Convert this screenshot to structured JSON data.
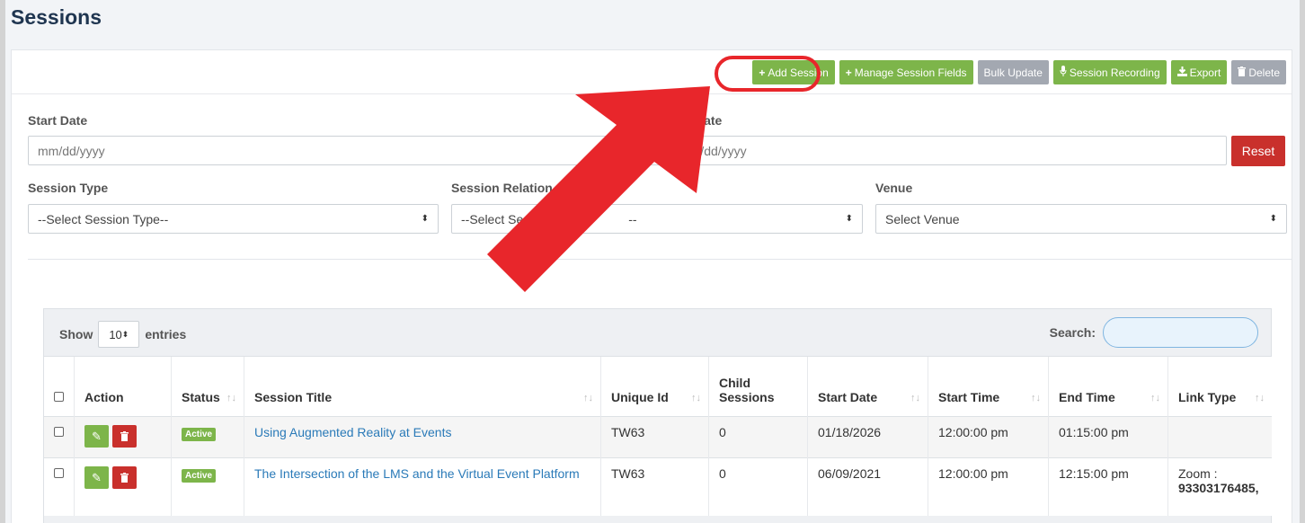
{
  "page_title": "Sessions",
  "toolbar": {
    "add_session": "Add Session",
    "manage_fields": "Manage Session Fields",
    "bulk_update": "Bulk Update",
    "session_recording": "Session Recording",
    "export": "Export",
    "delete": "Delete"
  },
  "filters": {
    "start_date_label": "Start Date",
    "start_date_placeholder": "mm/dd/yyyy",
    "end_date_label": "Date",
    "end_date_placeholder": "mm/dd/yyyy",
    "reset": "Reset",
    "session_type_label": "Session Type",
    "session_type_value": "--Select Session Type--",
    "session_relation_label": "Session Relation",
    "session_relation_value": "--Select Ses",
    "session_relation_value_tail": "--",
    "venue_label": "Venue",
    "venue_value": "Select Venue"
  },
  "table": {
    "show_label": "Show",
    "per_page": "10",
    "entries_label": "entries",
    "search_label": "Search:",
    "headers": {
      "action": "Action",
      "status": "Status",
      "title": "Session Title",
      "unique_id": "Unique Id",
      "child": "Child Sessions",
      "start_date": "Start Date",
      "start_time": "Start Time",
      "end_time": "End Time",
      "link_type": "Link Type"
    },
    "rows": [
      {
        "status": "Active",
        "title": "Using Augmented Reality at Events",
        "unique_id": "TW63",
        "child": "0",
        "start_date": "01/18/2026",
        "start_time": "12:00:00 pm",
        "end_time": "01:15:00 pm",
        "link_type": "",
        "link_number": ""
      },
      {
        "status": "Active",
        "title": "The Intersection of the LMS and the Virtual Event Platform",
        "unique_id": "TW63",
        "child": "0",
        "start_date": "06/09/2021",
        "start_time": "12:00:00 pm",
        "end_time": "12:15:00 pm",
        "link_type": "Zoom :",
        "link_number": "93303176485,"
      }
    ]
  },
  "colors": {
    "primary_green": "#7db54a",
    "danger_red": "#c9302c",
    "annotation_red": "#e8262b",
    "neutral_gray": "#a3a8b1"
  }
}
